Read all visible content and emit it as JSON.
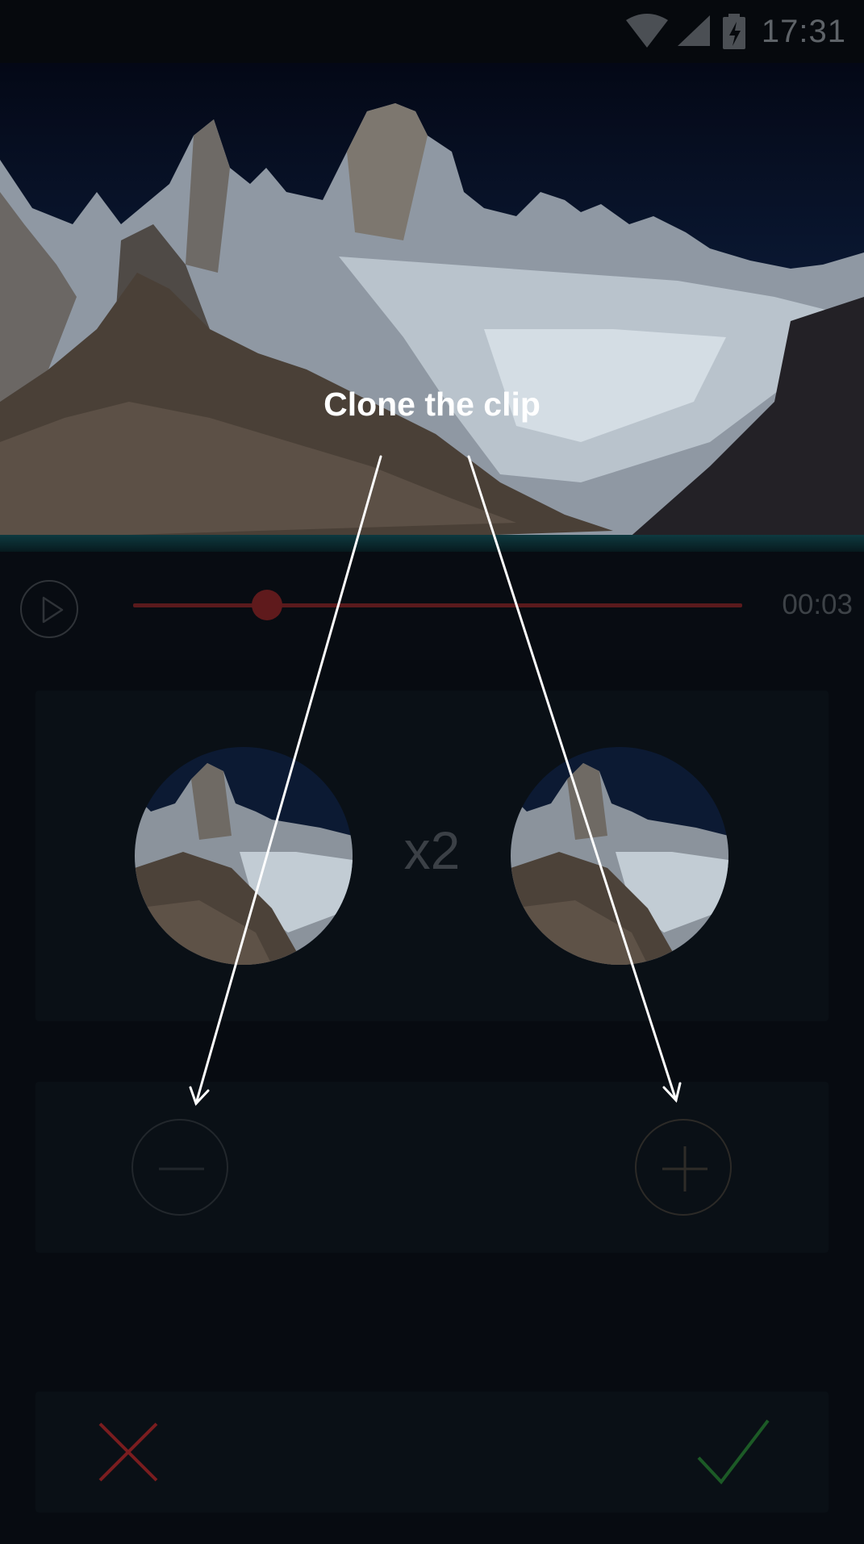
{
  "status_bar": {
    "time": "17:31",
    "icons": [
      "wifi-icon",
      "signal-icon",
      "battery-charging-icon"
    ]
  },
  "player": {
    "elapsed_time": "00:03",
    "progress": 0.22,
    "play_icon": "play-icon"
  },
  "clone": {
    "multiplier": "x2"
  },
  "stepper": {
    "decrease_icon": "minus-icon",
    "increase_icon": "plus-icon"
  },
  "actions": {
    "cancel_icon": "close-icon",
    "confirm_icon": "check-icon"
  },
  "tutorial": {
    "text": "Clone the clip"
  },
  "colors": {
    "accent_red": "#7a1d1f",
    "confirm_green": "#1c5a26",
    "overlay": "rgba(0,0,0,0.78)"
  }
}
